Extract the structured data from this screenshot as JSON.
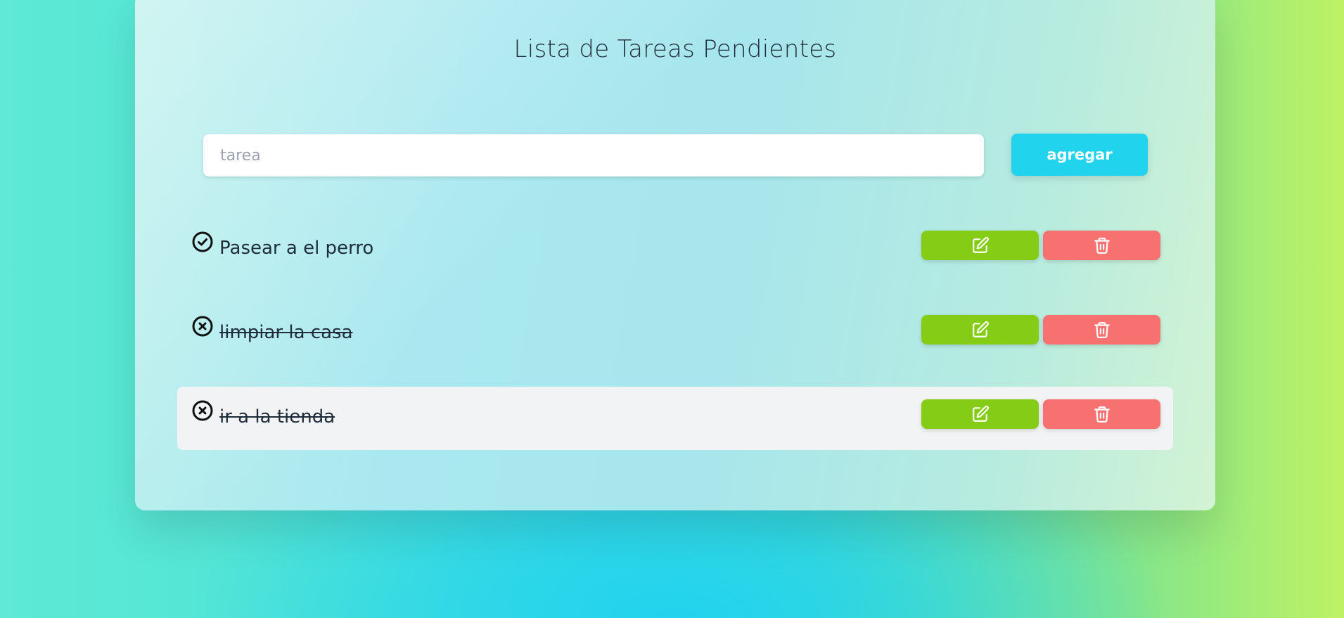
{
  "header": {
    "title": "Lista de Tareas Pendientes"
  },
  "form": {
    "input_value": "",
    "input_placeholder": "tarea",
    "add_label": "agregar"
  },
  "tasks": [
    {
      "text": "Pasear a el perro",
      "completed": false,
      "status_icon": "check-circle-icon"
    },
    {
      "text": "limpiar la casa",
      "completed": true,
      "status_icon": "x-circle-icon"
    },
    {
      "text": "ir a la tienda",
      "completed": true,
      "status_icon": "x-circle-icon",
      "hovered": true
    }
  ],
  "actions": {
    "edit_icon": "edit-icon",
    "delete_icon": "trash-icon"
  },
  "colors": {
    "accent": "#22d3ee",
    "edit": "#84cc16",
    "delete": "#f87171",
    "text": "#1f2d3a"
  }
}
